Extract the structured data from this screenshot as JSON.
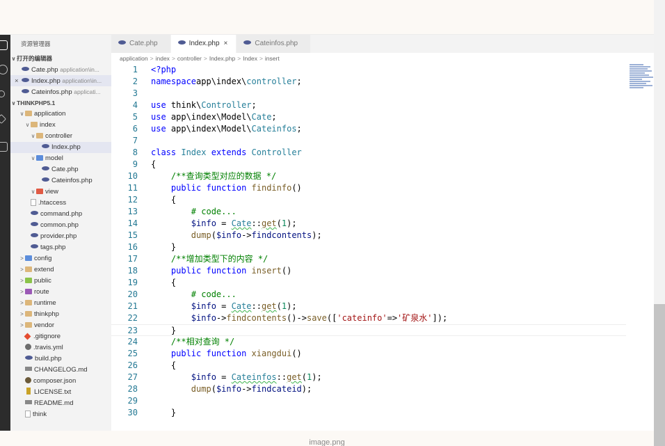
{
  "sidebar": {
    "title": "资源管理器",
    "open_editors_header": "打开的编辑器",
    "open_editors": [
      {
        "name": "Cate.php",
        "path": "application\\in...",
        "close": ""
      },
      {
        "name": "Index.php",
        "path": "application\\in...",
        "close": "×"
      },
      {
        "name": "Cateinfos.php",
        "path": "applicati...",
        "close": ""
      }
    ],
    "project_header": "THINKPHP5.1",
    "tree": [
      {
        "label": "application",
        "indent": 1,
        "twisty": "∨",
        "icon": "folder"
      },
      {
        "label": "index",
        "indent": 2,
        "twisty": "∨",
        "icon": "folder"
      },
      {
        "label": "controller",
        "indent": 3,
        "twisty": "∨",
        "icon": "folder"
      },
      {
        "label": "Index.php",
        "indent": 4,
        "twisty": "",
        "icon": "php",
        "selected": true
      },
      {
        "label": "model",
        "indent": 3,
        "twisty": "∨",
        "icon": "folder-blue"
      },
      {
        "label": "Cate.php",
        "indent": 4,
        "twisty": "",
        "icon": "php"
      },
      {
        "label": "Cateinfos.php",
        "indent": 4,
        "twisty": "",
        "icon": "php"
      },
      {
        "label": "view",
        "indent": 3,
        "twisty": "∨",
        "icon": "folder-red"
      },
      {
        "label": ".htaccess",
        "indent": 2,
        "twisty": "",
        "icon": "file"
      },
      {
        "label": "command.php",
        "indent": 2,
        "twisty": "",
        "icon": "php"
      },
      {
        "label": "common.php",
        "indent": 2,
        "twisty": "",
        "icon": "php"
      },
      {
        "label": "provider.php",
        "indent": 2,
        "twisty": "",
        "icon": "php"
      },
      {
        "label": "tags.php",
        "indent": 2,
        "twisty": "",
        "icon": "php"
      },
      {
        "label": "config",
        "indent": 1,
        "twisty": ">",
        "icon": "folder-blue"
      },
      {
        "label": "extend",
        "indent": 1,
        "twisty": ">",
        "icon": "folder"
      },
      {
        "label": "public",
        "indent": 1,
        "twisty": ">",
        "icon": "folder-green"
      },
      {
        "label": "route",
        "indent": 1,
        "twisty": ">",
        "icon": "folder-purple"
      },
      {
        "label": "runtime",
        "indent": 1,
        "twisty": ">",
        "icon": "folder"
      },
      {
        "label": "thinkphp",
        "indent": 1,
        "twisty": ">",
        "icon": "folder"
      },
      {
        "label": "vendor",
        "indent": 1,
        "twisty": ">",
        "icon": "folder"
      },
      {
        "label": ".gitignore",
        "indent": 1,
        "twisty": "",
        "icon": "git"
      },
      {
        "label": ".travis.yml",
        "indent": 1,
        "twisty": "",
        "icon": "travis"
      },
      {
        "label": "build.php",
        "indent": 1,
        "twisty": "",
        "icon": "php"
      },
      {
        "label": "CHANGELOG.md",
        "indent": 1,
        "twisty": "",
        "icon": "md"
      },
      {
        "label": "composer.json",
        "indent": 1,
        "twisty": "",
        "icon": "composer"
      },
      {
        "label": "LICENSE.txt",
        "indent": 1,
        "twisty": "",
        "icon": "license"
      },
      {
        "label": "README.md",
        "indent": 1,
        "twisty": "",
        "icon": "md"
      },
      {
        "label": "think",
        "indent": 1,
        "twisty": "",
        "icon": "file"
      }
    ]
  },
  "tabs": [
    {
      "label": "Cate.php",
      "active": false,
      "close": ""
    },
    {
      "label": "Index.php",
      "active": true,
      "close": "×"
    },
    {
      "label": "Cateinfos.php",
      "active": false,
      "close": ""
    }
  ],
  "breadcrumb": [
    "application",
    "index",
    "controller",
    "Index.php",
    "Index",
    "insert"
  ],
  "code_lines": [
    {
      "n": "1",
      "t": [
        [
          "kw",
          "<?php"
        ]
      ]
    },
    {
      "n": "2",
      "t": [
        [
          "kw",
          "namespace"
        ],
        [
          "",
          "app\\index\\"
        ],
        [
          "ty",
          "controller"
        ],
        [
          "",
          ";"
        ]
      ]
    },
    {
      "n": "3",
      "t": []
    },
    {
      "n": "4",
      "t": [
        [
          "kw",
          "use"
        ],
        [
          "",
          " think\\"
        ],
        [
          "ty",
          "Controller"
        ],
        [
          "",
          ";"
        ]
      ]
    },
    {
      "n": "5",
      "t": [
        [
          "kw",
          "use"
        ],
        [
          "",
          " app\\index\\Model\\"
        ],
        [
          "ty",
          "Cate"
        ],
        [
          "",
          ";"
        ]
      ]
    },
    {
      "n": "6",
      "t": [
        [
          "kw",
          "use"
        ],
        [
          "",
          " app\\index\\Model\\"
        ],
        [
          "ty",
          "Cateinfos"
        ],
        [
          "",
          ";"
        ]
      ]
    },
    {
      "n": "7",
      "t": []
    },
    {
      "n": "8",
      "t": [
        [
          "kw",
          "class"
        ],
        [
          "",
          " "
        ],
        [
          "ty",
          "Index"
        ],
        [
          "",
          " "
        ],
        [
          "kw",
          "extends"
        ],
        [
          "",
          " "
        ],
        [
          "ty",
          "Controller"
        ]
      ]
    },
    {
      "n": "9",
      "t": [
        [
          "",
          "{"
        ]
      ]
    },
    {
      "n": "10",
      "t": [
        [
          "",
          "    "
        ],
        [
          "cm",
          "/**查询类型对应的数据 */"
        ]
      ]
    },
    {
      "n": "11",
      "t": [
        [
          "",
          "    "
        ],
        [
          "kw",
          "public"
        ],
        [
          "",
          " "
        ],
        [
          "kw",
          "function"
        ],
        [
          "",
          " "
        ],
        [
          "fn",
          "findinfo"
        ],
        [
          "",
          "()"
        ]
      ]
    },
    {
      "n": "12",
      "t": [
        [
          "",
          "    {"
        ]
      ]
    },
    {
      "n": "13",
      "t": [
        [
          "",
          "        "
        ],
        [
          "cm",
          "# code..."
        ]
      ]
    },
    {
      "n": "14",
      "t": [
        [
          "",
          "        "
        ],
        [
          "vr",
          "$info"
        ],
        [
          "",
          " = "
        ],
        [
          "ty ul",
          "Cate"
        ],
        [
          "",
          "::"
        ],
        [
          "fn ul",
          "get"
        ],
        [
          "",
          "("
        ],
        [
          "nm",
          "1"
        ],
        [
          "",
          ");"
        ]
      ]
    },
    {
      "n": "15",
      "t": [
        [
          "",
          "        "
        ],
        [
          "fn",
          "dump"
        ],
        [
          "",
          "("
        ],
        [
          "vr",
          "$info"
        ],
        [
          "",
          "->"
        ],
        [
          "vr",
          "findcontents"
        ],
        [
          "",
          ");"
        ]
      ]
    },
    {
      "n": "16",
      "t": [
        [
          "",
          "    }"
        ]
      ]
    },
    {
      "n": "17",
      "t": [
        [
          "",
          "    "
        ],
        [
          "cm",
          "/**增加类型下的内容 */"
        ]
      ]
    },
    {
      "n": "18",
      "t": [
        [
          "",
          "    "
        ],
        [
          "kw",
          "public"
        ],
        [
          "",
          " "
        ],
        [
          "kw",
          "function"
        ],
        [
          "",
          " "
        ],
        [
          "fn",
          "insert"
        ],
        [
          "",
          "()"
        ]
      ]
    },
    {
      "n": "19",
      "t": [
        [
          "",
          "    {"
        ]
      ]
    },
    {
      "n": "20",
      "t": [
        [
          "",
          "        "
        ],
        [
          "cm",
          "# code..."
        ]
      ]
    },
    {
      "n": "21",
      "t": [
        [
          "",
          "        "
        ],
        [
          "vr",
          "$info"
        ],
        [
          "",
          " = "
        ],
        [
          "ty ul",
          "Cate"
        ],
        [
          "",
          "::"
        ],
        [
          "fn ul",
          "get"
        ],
        [
          "",
          "("
        ],
        [
          "nm",
          "1"
        ],
        [
          "",
          ");"
        ]
      ]
    },
    {
      "n": "22",
      "t": [
        [
          "",
          "        "
        ],
        [
          "vr",
          "$info"
        ],
        [
          "",
          "->"
        ],
        [
          "fn",
          "findcontents"
        ],
        [
          "",
          "()->"
        ],
        [
          "fn",
          "save"
        ],
        [
          "",
          "(["
        ],
        [
          "st",
          "'cateinfo'"
        ],
        [
          "",
          "=>"
        ],
        [
          "st",
          "'矿泉水'"
        ],
        [
          "",
          "]);"
        ]
      ]
    },
    {
      "n": "23",
      "t": [
        [
          "",
          "    }"
        ]
      ],
      "current": true
    },
    {
      "n": "24",
      "t": [
        [
          "",
          "    "
        ],
        [
          "cm",
          "/**相对查询 */"
        ]
      ]
    },
    {
      "n": "25",
      "t": [
        [
          "",
          "    "
        ],
        [
          "kw",
          "public"
        ],
        [
          "",
          " "
        ],
        [
          "kw",
          "function"
        ],
        [
          "",
          " "
        ],
        [
          "fn",
          "xiangdui"
        ],
        [
          "",
          "()"
        ]
      ]
    },
    {
      "n": "26",
      "t": [
        [
          "",
          "    {"
        ]
      ]
    },
    {
      "n": "27",
      "t": [
        [
          "",
          "        "
        ],
        [
          "vr",
          "$info"
        ],
        [
          "",
          " = "
        ],
        [
          "ty ul",
          "Cateinfos"
        ],
        [
          "",
          "::"
        ],
        [
          "fn ul",
          "get"
        ],
        [
          "",
          "("
        ],
        [
          "nm",
          "1"
        ],
        [
          "",
          ");"
        ]
      ]
    },
    {
      "n": "28",
      "t": [
        [
          "",
          "        "
        ],
        [
          "fn",
          "dump"
        ],
        [
          "",
          "("
        ],
        [
          "vr",
          "$info"
        ],
        [
          "",
          "->"
        ],
        [
          "vr",
          "findcateid"
        ],
        [
          "",
          ");"
        ]
      ]
    },
    {
      "n": "29",
      "t": []
    },
    {
      "n": "30",
      "t": [
        [
          "",
          "    }"
        ]
      ]
    }
  ],
  "caption": "image.png",
  "colors": {
    "keyword": "#0000ff",
    "type": "#267f99",
    "comment": "#008000",
    "string": "#a31515",
    "line_number": "#237893"
  }
}
